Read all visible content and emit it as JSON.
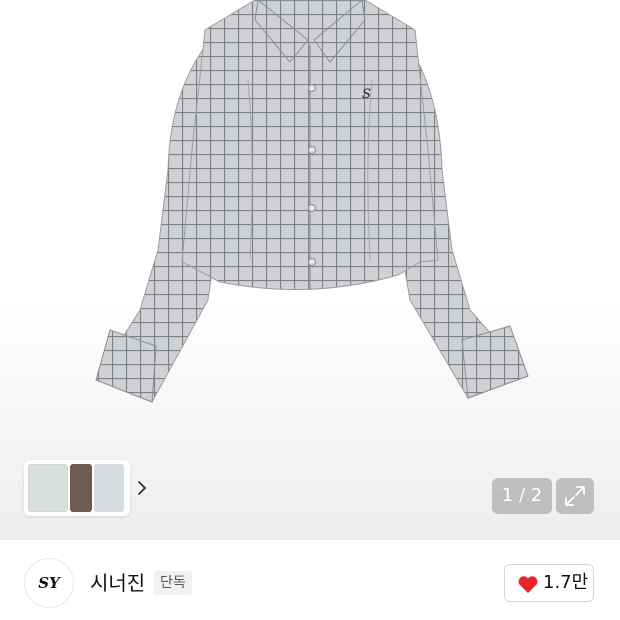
{
  "gallery": {
    "counter": "1 / 2",
    "thumbnails": [
      "shirt-flat-thumbnail",
      "model-thumbnail",
      "shirt-detail-thumbnail"
    ],
    "colors": {
      "shirt": "#cfd0d2",
      "grid": "#7d7f86"
    }
  },
  "brand": {
    "logo_text": "SY",
    "name": "시너진",
    "tag": "단독"
  },
  "like": {
    "count": "1.7만",
    "color": "#e8232b"
  }
}
